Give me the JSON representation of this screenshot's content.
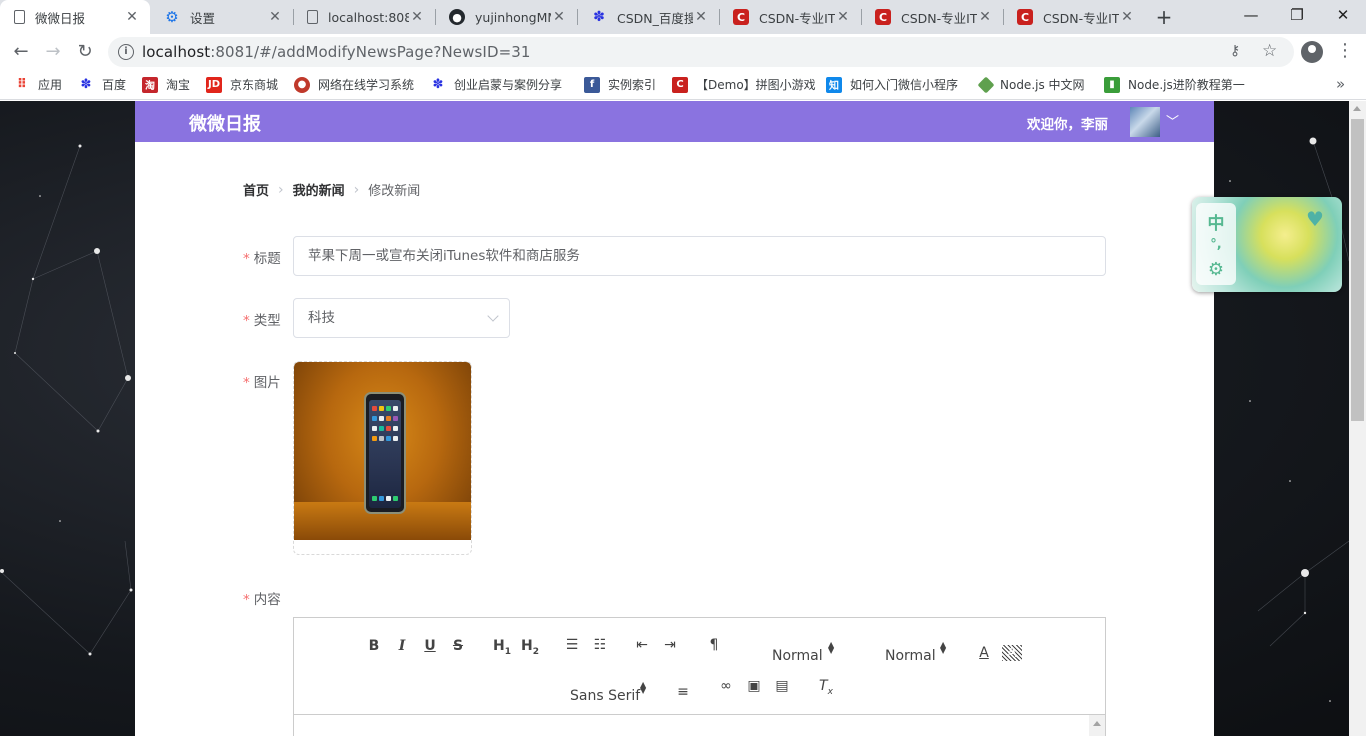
{
  "browser": {
    "tabs": [
      {
        "title": "微微日报",
        "favicon": "document-icon",
        "active": true
      },
      {
        "title": "设置",
        "favicon": "gear-icon"
      },
      {
        "title": "localhost:808",
        "favicon": "document-icon"
      },
      {
        "title": "yujinhongMM",
        "favicon": "github-icon"
      },
      {
        "title": "CSDN_百度搜",
        "favicon": "baidu-paw-icon"
      },
      {
        "title": "CSDN-专业IT",
        "favicon": "csdn-icon"
      },
      {
        "title": "CSDN-专业IT",
        "favicon": "csdn-icon"
      },
      {
        "title": "CSDN-专业IT",
        "favicon": "csdn-icon"
      }
    ],
    "address": {
      "host": "localhost",
      "rest": ":8081/#/addModifyNewsPage?NewsID=31"
    },
    "bookmarks": [
      {
        "label": "应用",
        "icon": "apps-grid-icon",
        "color": "#ea4335"
      },
      {
        "label": "百度",
        "icon": "baidu-paw-icon",
        "color": "#2932e1"
      },
      {
        "label": "淘宝",
        "icon": "taobao-icon",
        "color": "#c4262c"
      },
      {
        "label": "京东商城",
        "icon": "jd-icon",
        "color": "#e1251b"
      },
      {
        "label": "网络在线学习系统",
        "icon": "circle-icon",
        "color": "#c0392b"
      },
      {
        "label": "创业启蒙与案例分享",
        "icon": "baidu-paw-icon",
        "color": "#2932e1"
      },
      {
        "label": "实例索引",
        "icon": "facebook-icon",
        "color": "#3b5998"
      },
      {
        "label": "【Demo】拼图小游戏",
        "icon": "csdn-icon",
        "color": "#c9211e"
      },
      {
        "label": "如何入门微信小程序",
        "icon": "zhihu-icon",
        "color": "#0f88eb"
      },
      {
        "label": "Node.js 中文网",
        "icon": "nodejs-icon",
        "color": "#5fa04e"
      },
      {
        "label": "Node.js进阶教程第一",
        "icon": "book-icon",
        "color": "#3a9d3a"
      }
    ]
  },
  "app": {
    "brand": "微微日报",
    "welcome": "欢迎你，李丽",
    "breadcrumb": {
      "home": "首页",
      "mine": "我的新闻",
      "current": "修改新闻"
    },
    "form": {
      "title_label": "标题",
      "title_value": "苹果下周一或宣布关闭iTunes软件和商店服务",
      "type_label": "类型",
      "type_value": "科技",
      "image_label": "图片",
      "content_label": "内容"
    },
    "editor": {
      "size_picker": "Normal",
      "header_picker": "Normal",
      "font_picker": "Sans Serif"
    }
  },
  "ime": {
    "lang_key": "中",
    "punct_key": "°,",
    "settings_icon": "gear-icon"
  },
  "colors": {
    "header": "#8a73e0",
    "required": "#f56c6c"
  }
}
